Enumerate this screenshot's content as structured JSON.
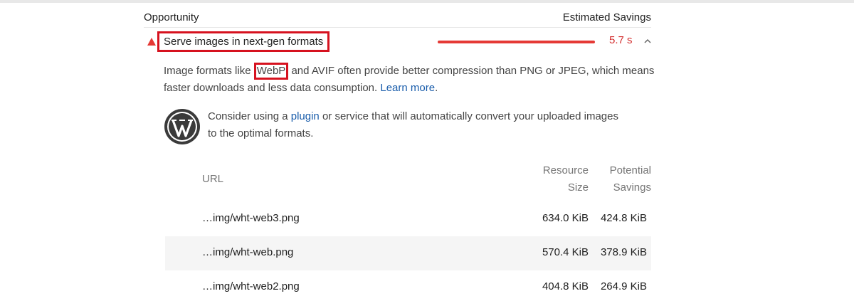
{
  "header": {
    "opportunity_label": "Opportunity",
    "savings_label": "Estimated Savings"
  },
  "audit": {
    "title": "Serve images in next-gen formats",
    "savings": "5.7 s",
    "status_color": "#e53935",
    "warn_icon": "warning-triangle-icon",
    "expand_icon": "chevron-up-icon"
  },
  "description": {
    "prefix": "Image formats like ",
    "highlight": "WebP",
    "suffix": " and AVIF often provide better compression than PNG or JPEG, which means faster downloads and less data consumption. ",
    "link": "Learn more",
    "end": "."
  },
  "wordpress_tip": {
    "icon": "wordpress-logo-icon",
    "prefix": "Consider using a ",
    "link": "plugin",
    "suffix": " or service that will automatically convert your uploaded images to the optimal formats."
  },
  "table": {
    "columns": {
      "url": "URL",
      "resource_size_line1": "Resource",
      "resource_size_line2": "Size",
      "potential_savings_line1": "Potential",
      "potential_savings_line2": "Savings"
    },
    "rows": [
      {
        "url": "…img/wht-web3.png",
        "size": "634.0 KiB",
        "savings": "424.8 KiB"
      },
      {
        "url": "…img/wht-web.png",
        "size": "570.4 KiB",
        "savings": "378.9 KiB"
      },
      {
        "url": "…img/wht-web2.png",
        "size": "404.8 KiB",
        "savings": "264.9 KiB"
      }
    ]
  }
}
